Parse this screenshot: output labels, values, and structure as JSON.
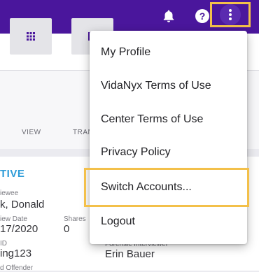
{
  "topbar": {
    "icons": [
      "bell-icon",
      "help-icon",
      "more-vert-icon"
    ],
    "highlight_color": "#f3c04a",
    "background_color": "#4a169c"
  },
  "toolbar": {
    "tiles": [
      {
        "label": "VIEW",
        "icon": "grid-icon"
      },
      {
        "label": "TRAN",
        "icon": "transcript-icon"
      }
    ]
  },
  "detail": {
    "status": "TIVE",
    "interviewee_label": "iewee",
    "interviewee_value": "k, Donald",
    "interview_date_label": "iew Date",
    "interview_date_value": "17/2020",
    "shares_label": "Shares",
    "shares_value": "0",
    "id_label": "ID",
    "id_value": "ing123",
    "forensic_label": "Forensic Interviewer",
    "forensic_value": "Erin Bauer",
    "offender_label": "d Offender"
  },
  "menu": {
    "items": [
      {
        "label": "My Profile"
      },
      {
        "label": "VidaNyx Terms of Use"
      },
      {
        "label": "Center Terms of Use"
      },
      {
        "label": "Privacy Policy"
      },
      {
        "label": "Switch Accounts..."
      },
      {
        "label": "Logout"
      }
    ],
    "highlighted_item": "Switch Accounts..."
  }
}
